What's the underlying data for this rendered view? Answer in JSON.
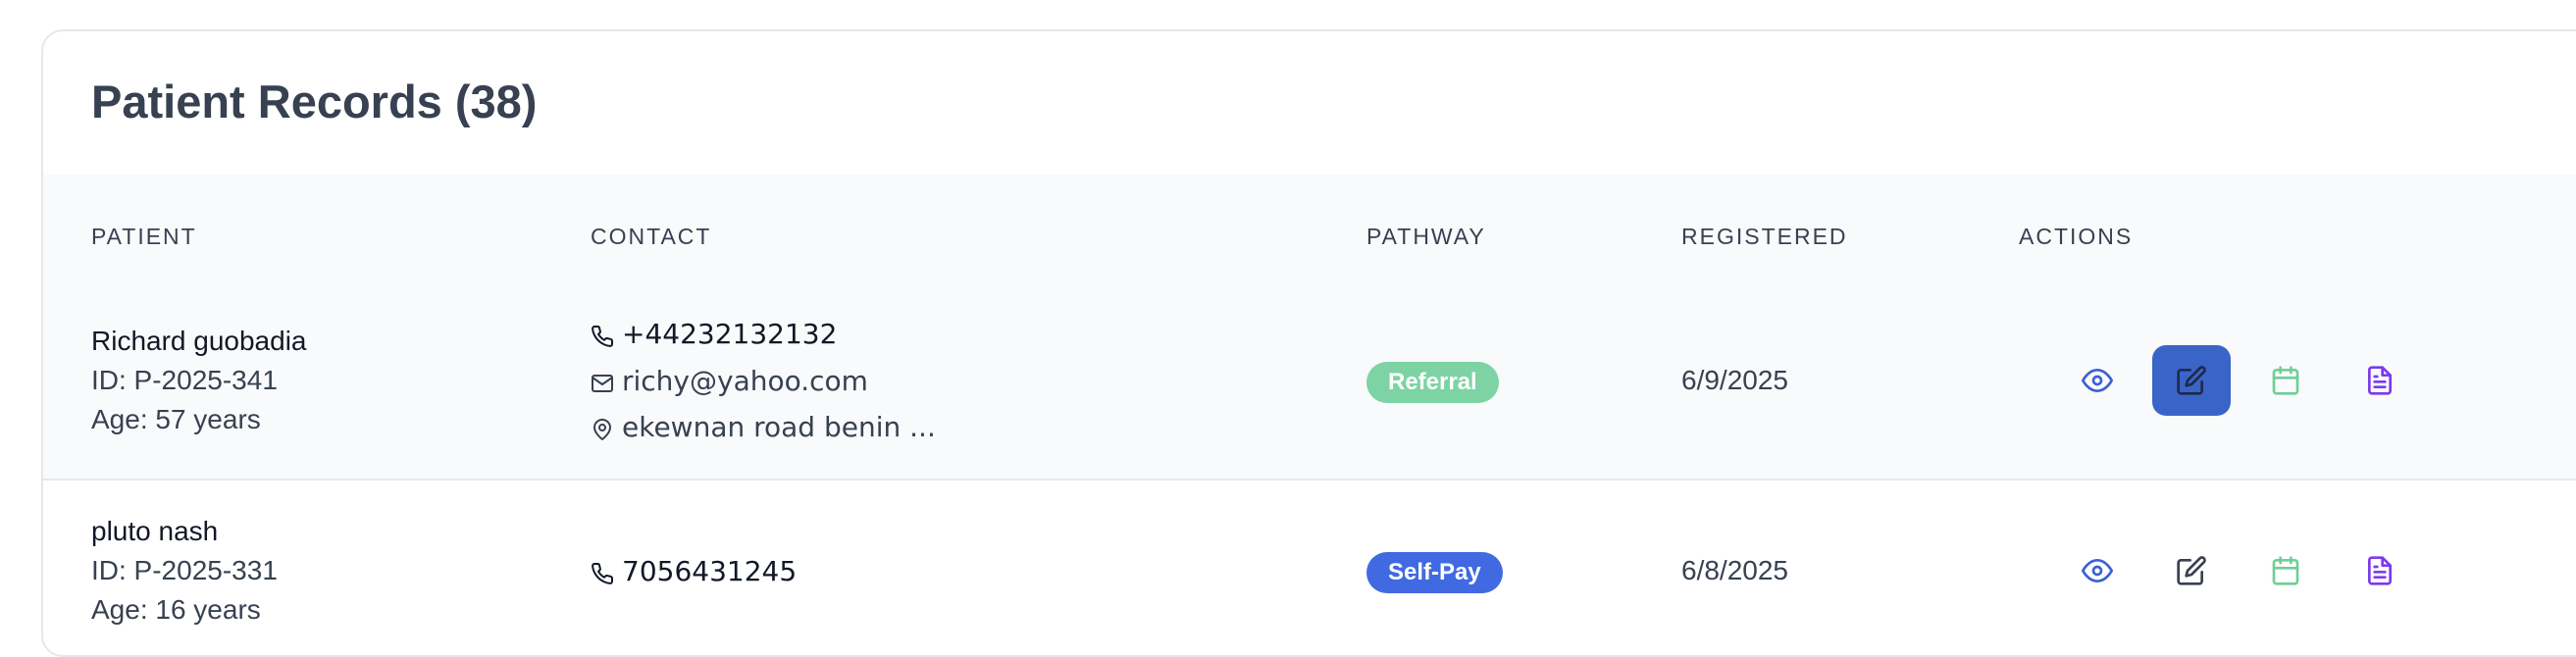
{
  "header": {
    "title": "Patient Records (38)"
  },
  "columns": {
    "patient": "PATIENT",
    "contact": "CONTACT",
    "pathway": "PATHWAY",
    "registered": "REGISTERED",
    "actions": "ACTIONS"
  },
  "rows": [
    {
      "name": "Richard guobadia",
      "id": "ID: P-2025-341",
      "age": "Age: 57 years",
      "phone": "+44232132132",
      "email": "richy@yahoo.com",
      "address": "ekewnan road benin ...",
      "pathway": "Referral",
      "pathway_color": "#7dd3a4",
      "registered": "6/9/2025"
    },
    {
      "name": "pluto nash",
      "id": "ID: P-2025-331",
      "age": "Age: 16 years",
      "phone": "7056431245",
      "pathway": "Self-Pay",
      "pathway_color": "#4169e1",
      "registered": "6/8/2025"
    }
  ],
  "icons": {
    "view": "eye-icon",
    "edit": "edit-icon",
    "schedule": "calendar-icon",
    "records": "document-icon",
    "phone": "phone-icon",
    "email": "mail-icon",
    "address": "map-pin-icon"
  },
  "colors": {
    "view_icon": "#3b5fd6",
    "edit_active_bg": "#3a65c8",
    "edit_icon": "#374151",
    "calendar_icon": "#6fcf97",
    "document_icon": "#7c3aed"
  }
}
